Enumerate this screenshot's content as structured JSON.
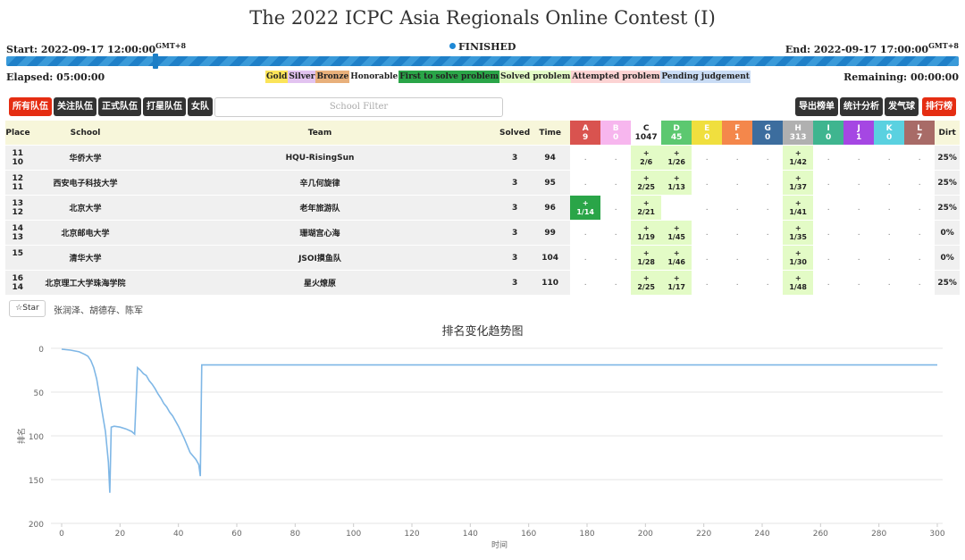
{
  "title": "The 2022 ICPC Asia Regionals Online Contest (I)",
  "start": {
    "label": "Start: 2022-09-17 12:00:00",
    "tz": "GMT+8"
  },
  "status": "FINISHED",
  "end": {
    "label": "End: 2022-09-17 17:00:00",
    "tz": "GMT+8"
  },
  "progress": 1.0,
  "elapsed": "Elapsed: 05:00:00",
  "remaining": "Remaining: 00:00:00",
  "legend": [
    {
      "label": "Gold",
      "color": "#fbe459"
    },
    {
      "label": "Silver",
      "color": "#e2c3f0"
    },
    {
      "label": "Bronze",
      "color": "#e8b07b"
    },
    {
      "label": "Honorable",
      "color": "#ffffff"
    },
    {
      "label": "First to solve problem",
      "color": "#2aa548"
    },
    {
      "label": "Solved problem",
      "color": "#e3fbc6"
    },
    {
      "label": "Attempted problem",
      "color": "#fcd3d3"
    },
    {
      "label": "Pending judgement",
      "color": "#c9dcf5"
    }
  ],
  "toolbar": {
    "left": [
      "所有队伍",
      "关注队伍",
      "正式队伍",
      "打星队伍",
      "女队"
    ],
    "filter_placeholder": "School Filter",
    "right": [
      "导出榜单",
      "统计分析",
      "发气球",
      "排行榜"
    ]
  },
  "headers": {
    "place": "Place",
    "school": "School",
    "team": "Team",
    "solved": "Solved",
    "time": "Time",
    "dirt": "Dirt"
  },
  "problems": [
    {
      "id": "A",
      "count": "9",
      "color": "#d9534f"
    },
    {
      "id": "B",
      "count": "0",
      "color": "#f7b6ee"
    },
    {
      "id": "C",
      "count": "1047",
      "color": "#ffffff"
    },
    {
      "id": "D",
      "count": "45",
      "color": "#5cc870"
    },
    {
      "id": "E",
      "count": "0",
      "color": "#f0df3e"
    },
    {
      "id": "F",
      "count": "1",
      "color": "#f4874b"
    },
    {
      "id": "G",
      "count": "0",
      "color": "#3c6d9e"
    },
    {
      "id": "H",
      "count": "313",
      "color": "#b0b0b0"
    },
    {
      "id": "I",
      "count": "0",
      "color": "#3fb58f"
    },
    {
      "id": "J",
      "count": "1",
      "color": "#a547e3"
    },
    {
      "id": "K",
      "count": "0",
      "color": "#5ad1e0"
    },
    {
      "id": "L",
      "count": "7",
      "color": "#a86b67"
    }
  ],
  "rows": [
    {
      "place": "11",
      "rank": "10",
      "school": "华侨大学",
      "team": "HQU-RisingSun",
      "solved": "3",
      "time": "94",
      "dirt": "25%",
      "cells": [
        ".",
        ".",
        "+\n2/6",
        "+\n1/26",
        ".",
        ".",
        ".",
        "+\n1/42",
        ".",
        ".",
        ".",
        "."
      ]
    },
    {
      "place": "12",
      "rank": "11",
      "school": "西安电子科技大学",
      "team": "辛几何旋律",
      "solved": "3",
      "time": "95",
      "dirt": "25%",
      "cells": [
        ".",
        ".",
        "+\n2/25",
        "+\n1/13",
        ".",
        ".",
        ".",
        "+\n1/37",
        ".",
        ".",
        ".",
        "."
      ]
    },
    {
      "place": "13",
      "rank": "12",
      "school": "北京大学",
      "team": "老年旅游队",
      "solved": "3",
      "time": "96",
      "dirt": "25%",
      "cells": [
        "F+\n1/14",
        ".",
        "+\n2/21",
        "",
        ".",
        ".",
        ".",
        "+\n1/41",
        ".",
        ".",
        ".",
        "."
      ]
    },
    {
      "place": "14",
      "rank": "13",
      "school": "北京邮电大学",
      "team": "珊瑚宫心海",
      "solved": "3",
      "time": "99",
      "dirt": "0%",
      "cells": [
        ".",
        ".",
        "+\n1/19",
        "+\n1/45",
        ".",
        ".",
        ".",
        "+\n1/35",
        ".",
        ".",
        ".",
        "."
      ]
    },
    {
      "place": "15",
      "rank": "",
      "school": "清华大学",
      "team": "JSOI摸鱼队",
      "solved": "3",
      "time": "104",
      "dirt": "0%",
      "cells": [
        ".",
        ".",
        "+\n1/28",
        "+\n1/46",
        ".",
        ".",
        ".",
        "+\n1/30",
        ".",
        ".",
        ".",
        "."
      ]
    },
    {
      "place": "16",
      "rank": "14",
      "school": "北京理工大学珠海学院",
      "team": "星火燎原",
      "solved": "3",
      "time": "110",
      "dirt": "25%",
      "cells": [
        ".",
        ".",
        "+\n2/25",
        "+\n1/17",
        ".",
        ".",
        ".",
        "+\n1/48",
        ".",
        ".",
        ".",
        "."
      ]
    }
  ],
  "star_label": "Star",
  "members": "张润泽、胡德存、陈军",
  "chart_data": {
    "type": "line",
    "title": "排名变化趋势图",
    "xlabel": "时间",
    "ylabel": "排名",
    "xlim": [
      0,
      300
    ],
    "ylim": [
      0,
      200
    ],
    "y_inverted": true,
    "xticks": [
      0,
      20,
      40,
      60,
      80,
      100,
      120,
      140,
      160,
      180,
      200,
      220,
      240,
      260,
      280,
      300
    ],
    "yticks": [
      0,
      50,
      100,
      150,
      200
    ],
    "grid": true,
    "color": "#7fb7e6",
    "x": [
      0,
      3,
      6,
      8,
      9,
      10,
      11,
      12,
      13,
      14,
      15,
      16,
      16.5,
      17,
      18,
      20,
      22,
      24,
      25,
      25.5,
      26,
      27,
      28,
      29,
      30,
      31,
      32,
      33,
      34,
      35,
      36,
      37,
      38,
      40,
      42,
      43,
      44,
      46,
      47,
      47.5,
      48,
      300
    ],
    "y": [
      1,
      2,
      4,
      7,
      9,
      14,
      22,
      35,
      55,
      75,
      95,
      130,
      165,
      90,
      89,
      90,
      92,
      95,
      98,
      60,
      22,
      25,
      29,
      31,
      37,
      41,
      46,
      52,
      57,
      63,
      67,
      73,
      77,
      89,
      103,
      111,
      119,
      127,
      133,
      146,
      19,
      19
    ]
  }
}
